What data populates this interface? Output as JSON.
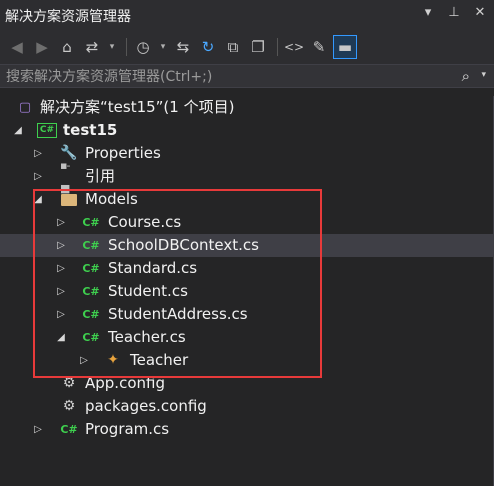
{
  "window": {
    "title": "解决方案资源管理器"
  },
  "toolbar": {
    "buttons": [
      {
        "name": "back-button",
        "icon": "back-icon",
        "glyph": "◀"
      },
      {
        "name": "forward-button",
        "icon": "forward-icon",
        "glyph": "▶"
      },
      {
        "name": "home-button",
        "icon": "home-icon",
        "glyph": "⌂"
      },
      {
        "name": "switch-views-button",
        "icon": "switch-views-icon",
        "glyph": "⇄"
      },
      {
        "name": "pending-changes-button",
        "icon": "clock-icon",
        "glyph": "◷"
      },
      {
        "name": "sync-button",
        "icon": "sync-icon",
        "glyph": "⇆"
      },
      {
        "name": "refresh-button",
        "icon": "refresh-icon",
        "glyph": "↻"
      },
      {
        "name": "collapse-all-button",
        "icon": "collapse-icon",
        "glyph": "⧉"
      },
      {
        "name": "show-all-files-button",
        "icon": "copy-icon",
        "glyph": "❐"
      },
      {
        "name": "view-code-button",
        "icon": "code-icon",
        "glyph": "<>"
      },
      {
        "name": "properties-button",
        "icon": "wrench-icon",
        "glyph": "🔧"
      },
      {
        "name": "preview-button",
        "icon": "preview-icon",
        "glyph": "▬"
      }
    ]
  },
  "search": {
    "placeholder": "搜索解决方案资源管理器(Ctrl+;)"
  },
  "tree": {
    "solution": "解决方案“test15”(1 个项目)",
    "project": "test15",
    "properties": "Properties",
    "references": "引用",
    "models": "Models",
    "files": {
      "course": "Course.cs",
      "schooldb": "SchoolDBContext.cs",
      "standard": "Standard.cs",
      "student": "Student.cs",
      "studentaddress": "StudentAddress.cs",
      "teacher": "Teacher.cs"
    },
    "teacher_class": "Teacher",
    "appconfig": "App.config",
    "packagesconfig": "packages.config",
    "program": "Program.cs"
  },
  "colors": {
    "highlight": "#e83a3a",
    "csharp": "#3ecf4e",
    "folder": "#dcb67a"
  }
}
